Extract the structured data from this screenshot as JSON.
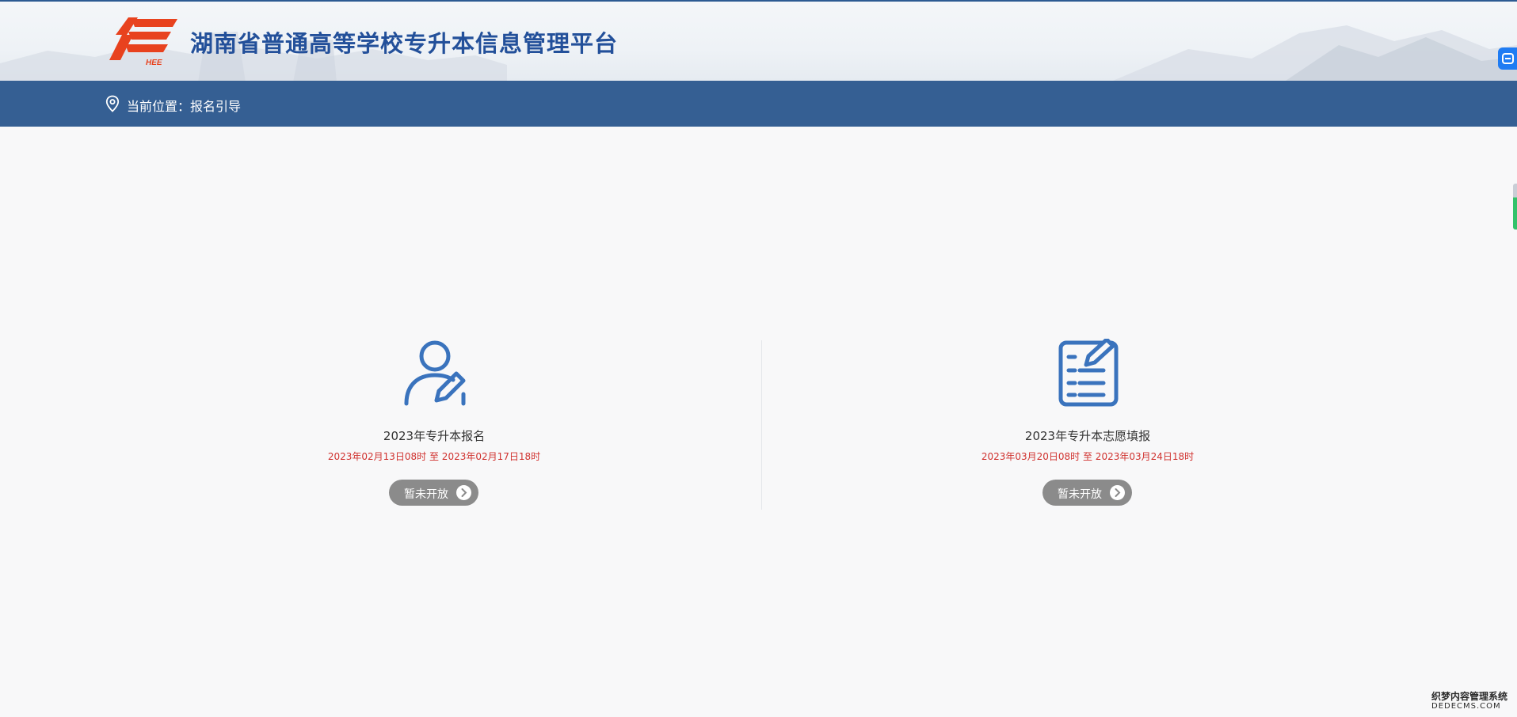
{
  "header": {
    "logo_text": "HEE",
    "title": "湖南省普通高等学校专升本信息管理平台"
  },
  "nav": {
    "location_label": "当前位置：",
    "location_value": "报名引导"
  },
  "cards": [
    {
      "icon": "user-edit-icon",
      "title": "2023年专升本报名",
      "time": "2023年02月13日08时 至 2023年02月17日18时",
      "button_label": "暂未开放"
    },
    {
      "icon": "document-edit-icon",
      "title": "2023年专升本志愿填报",
      "time": "2023年03月20日08时 至 2023年03月24日18时",
      "button_label": "暂未开放"
    }
  ],
  "watermark": {
    "line1": "织梦内容管理系统",
    "line2": "DEDECMS.COM"
  },
  "colors": {
    "title_blue": "#23509a",
    "nav_bar": "#355f93",
    "logo_red": "#e8421e",
    "icon_blue": "#3a73bd",
    "time_red": "#d0322f",
    "button_gray": "#8b8b8b"
  }
}
